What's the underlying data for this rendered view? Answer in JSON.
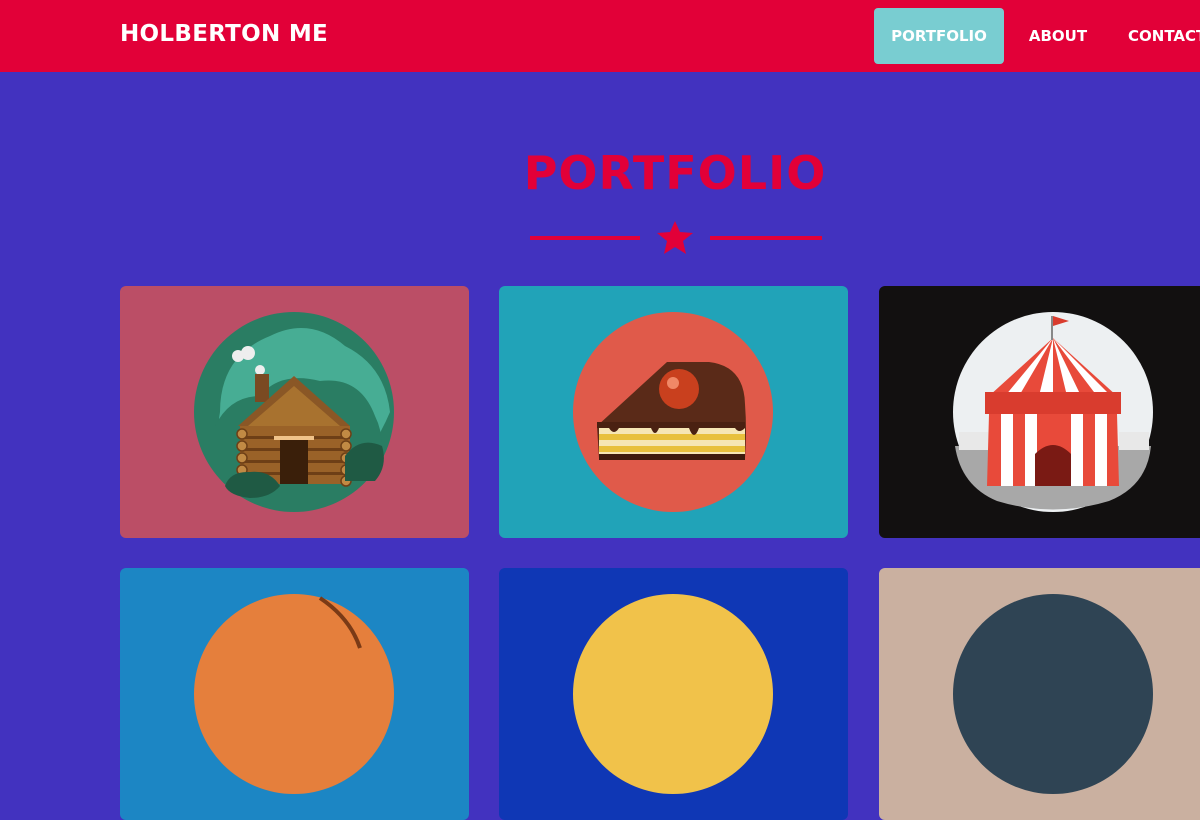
{
  "header": {
    "brand": "HOLBERTON ME",
    "nav": [
      {
        "label": "PORTFOLIO",
        "active": true
      },
      {
        "label": "ABOUT",
        "active": false
      },
      {
        "label": "CONTACT",
        "active": false
      }
    ]
  },
  "main": {
    "title": "PORTFOLIO",
    "divider_icon": "star-icon",
    "cards": [
      {
        "icon": "log-cabin-icon",
        "color": "#bb4e66"
      },
      {
        "icon": "cake-slice-icon",
        "color": "#21a3b8"
      },
      {
        "icon": "circus-tent-icon",
        "color": "#121010"
      },
      {
        "icon": "basketball-icon",
        "color": "#1c86c4"
      },
      {
        "icon": "yellow-circle-icon",
        "color": "#0f37b5"
      },
      {
        "icon": "dark-circle-icon",
        "color": "#cab0a0"
      }
    ]
  },
  "colors": {
    "header_bg": "#e20038",
    "page_bg": "#4232bf",
    "accent": "#e20038",
    "active_nav": "#79cdd1"
  }
}
